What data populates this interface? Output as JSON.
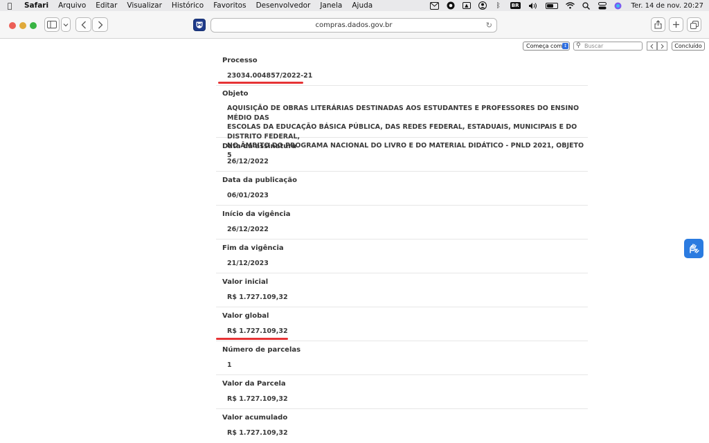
{
  "menubar": {
    "app": "Safari",
    "items": [
      "Arquivo",
      "Editar",
      "Visualizar",
      "Histórico",
      "Favoritos",
      "Desenvolvedor",
      "Janela",
      "Ajuda"
    ],
    "input_source": "BR",
    "datetime": "Ter. 14 de nov.  20:27"
  },
  "browser": {
    "url": "compras.dados.gov.br"
  },
  "findbar": {
    "mode": "Começa com",
    "search_placeholder": "Buscar",
    "done_label": "Concluído"
  },
  "contract": {
    "fields": [
      {
        "label": "Processo",
        "value": [
          "23034.004857/2022-21"
        ],
        "marked": true
      },
      {
        "label": "Objeto",
        "value": [
          "AQUISIÇÃO DE OBRAS LITERÁRIAS DESTINADAS AOS ESTUDANTES E PROFESSORES DO ENSINO MÉDIO DAS",
          "ESCOLAS DA EDUCAÇÃO BÁSICA PÚBLICA, DAS REDES FEDERAL, ESTADUAIS, MUNICIPAIS E DO DISTRITO FEDERAL,",
          "NO ÂMBITO DO PROGRAMA NACIONAL DO LIVRO E DO MATERIAL DIDÁTICO - PNLD 2021, OBJETO 5"
        ],
        "marked": false
      },
      {
        "label": "Data da assinatura",
        "value": [
          "26/12/2022"
        ],
        "marked": false
      },
      {
        "label": "Data da publicação",
        "value": [
          "06/01/2023"
        ],
        "marked": false
      },
      {
        "label": "Início da vigência",
        "value": [
          "26/12/2022"
        ],
        "marked": false
      },
      {
        "label": "Fim da vigência",
        "value": [
          "21/12/2023"
        ],
        "marked": false
      },
      {
        "label": "Valor inicial",
        "value": [
          "R$ 1.727.109,32"
        ],
        "marked": false
      },
      {
        "label": "Valor global",
        "value": [
          "R$ 1.727.109,32"
        ],
        "marked": true
      },
      {
        "label": "Número de parcelas",
        "value": [
          "1"
        ],
        "marked": false
      },
      {
        "label": "Valor da Parcela",
        "value": [
          "R$ 1.727.109,32"
        ],
        "marked": false
      },
      {
        "label": "Valor acumulado",
        "value": [
          "R$ 1.727.109,32"
        ],
        "marked": false
      }
    ]
  },
  "colors": {
    "highlight_mark": "#e63335",
    "accessibility_widget": "#2b7be0",
    "favicon": "#1e3a8a"
  }
}
